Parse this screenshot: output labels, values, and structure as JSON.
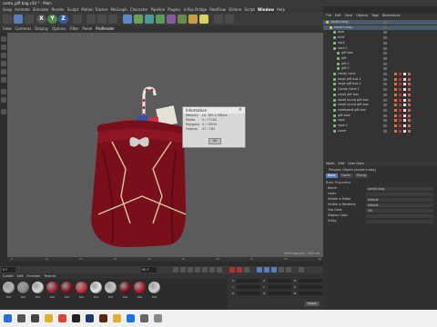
{
  "window": {
    "title": "santa_gift bag.c4d * - Main"
  },
  "menubar": {
    "items": [
      "Snap",
      "Animate",
      "Simulate",
      "Render",
      "Sculpt",
      "Motion Tracker",
      "MoGraph",
      "Character",
      "Pipeline",
      "Plugins",
      "V-Ray Bridge",
      "RealFlow",
      "Octane",
      "Script",
      "Window",
      "Help"
    ]
  },
  "toolbar": {
    "xyz": [
      "X",
      "Y",
      "Z"
    ]
  },
  "viewport_tabs": [
    "View",
    "Cameras",
    "Display",
    "Options",
    "Filter",
    "Panel",
    "ProRender"
  ],
  "viewport": {
    "grid_spacing": "Grid Spacing : 100 cm"
  },
  "info": {
    "title": "Information",
    "rows": [
      {
        "k": "Memory",
        "v": "ca. 189.2 MByte"
      },
      {
        "k": "Points",
        "v": "0 / 77182"
      },
      {
        "k": "Polygons",
        "v": "0 / 76930"
      },
      {
        "k": "Objects",
        "v": "47 / 284"
      }
    ],
    "ok": "OK"
  },
  "timeline": {
    "ticks": [
      "0",
      "10",
      "20",
      "30",
      "40",
      "50",
      "60",
      "70",
      "80",
      "90"
    ]
  },
  "playbar": {
    "frame": "0 F",
    "end_frame": "90 F"
  },
  "materials": {
    "menu": [
      "Create",
      "Edit",
      "Function",
      "Texture"
    ],
    "items": [
      {
        "label": "Mat",
        "color": "#b8b8b8"
      },
      {
        "label": "Mat",
        "color": "#8a8a8a"
      },
      {
        "label": "Mat",
        "color": "#d9d9d9"
      },
      {
        "label": "Mat",
        "color": "#a02030"
      },
      {
        "label": "Mat",
        "color": "#8a1020"
      },
      {
        "label": "Mat",
        "color": "#cc2a3a"
      },
      {
        "label": "Mat",
        "color": "#e8e8e8"
      },
      {
        "label": "Mat",
        "color": "#c8c8c8"
      },
      {
        "label": "Mat",
        "color": "#7a0c18"
      },
      {
        "label": "Mat",
        "color": "#b01a28"
      },
      {
        "label": "Mat",
        "color": "#d0d0d0"
      }
    ]
  },
  "coords": {
    "rows": [
      {
        "a": "X",
        "b": "X",
        "c": "H"
      },
      {
        "a": "Y",
        "b": "Y",
        "c": "P"
      },
      {
        "a": "Z",
        "b": "Z",
        "c": "B"
      }
    ],
    "apply": "Apply"
  },
  "object_manager": {
    "menu": [
      "File",
      "Edit",
      "View",
      "Objects",
      "Tags",
      "Bookmarks"
    ],
    "rows": [
      {
        "name": "santa's bag",
        "indent": 0,
        "color": "#d6c060",
        "sel": true
      },
      {
        "name": "santa's bag",
        "indent": 1,
        "color": "#d6c060",
        "sel": true
      },
      {
        "name": "bow",
        "indent": 2,
        "color": "#7fc07f",
        "sel": false
      },
      {
        "name": "knot",
        "indent": 2,
        "color": "#7fc07f",
        "sel": false
      },
      {
        "name": "sack",
        "indent": 2,
        "color": "#7fc07f",
        "sel": false
      },
      {
        "name": "sack.1",
        "indent": 2,
        "color": "#7fc07f",
        "sel": false
      },
      {
        "name": "gift box",
        "indent": 3,
        "color": "#7fc07f",
        "sel": false
      },
      {
        "name": "gift",
        "indent": 3,
        "color": "#7fc07f",
        "sel": false
      },
      {
        "name": "gift.1",
        "indent": 3,
        "color": "#7fc07f",
        "sel": false
      },
      {
        "name": "gift.2",
        "indent": 3,
        "color": "#7fc07f",
        "sel": false
      },
      {
        "name": "candy cane",
        "indent": 2,
        "color": "#7fc07f",
        "sel": false
      },
      {
        "name": "large gift box.1",
        "indent": 2,
        "color": "#7fc07f",
        "sel": false
      },
      {
        "name": "large gift box.2",
        "indent": 2,
        "color": "#7fc07f",
        "sel": false
      },
      {
        "name": "Candy Cane.1",
        "indent": 2,
        "color": "#7fc07f",
        "sel": false
      },
      {
        "name": "small gift box",
        "indent": 2,
        "color": "#7fc07f",
        "sel": false
      },
      {
        "name": "small round gift box",
        "indent": 2,
        "color": "#7fc07f",
        "sel": false
      },
      {
        "name": "small round gift box",
        "indent": 2,
        "color": "#7fc07f",
        "sel": false
      },
      {
        "name": "cardboard gift box",
        "indent": 2,
        "color": "#7fc07f",
        "sel": false
      },
      {
        "name": "gift bow",
        "indent": 2,
        "color": "#7fc07f",
        "sel": false
      },
      {
        "name": "rope",
        "indent": 2,
        "color": "#7fc07f",
        "sel": false
      },
      {
        "name": "rope.1",
        "indent": 2,
        "color": "#7fc07f",
        "sel": false
      },
      {
        "name": "cover",
        "indent": 2,
        "color": "#7fc07f",
        "sel": false
      }
    ]
  },
  "attributes": {
    "menu": [
      "Mode",
      "Edit",
      "User Data"
    ],
    "title": "Polygon Object [santa's bag]",
    "tabs": [
      "Basic",
      "Coord.",
      "Phong"
    ],
    "active_tab": "Basic",
    "section": "Basic Properties",
    "rows": [
      {
        "label": "Name",
        "value": "santa's bag"
      },
      {
        "label": "Layer",
        "value": ""
      },
      {
        "label": "Visible in Editor",
        "value": "Default"
      },
      {
        "label": "Visible in Renderer",
        "value": "Default"
      },
      {
        "label": "Use Color",
        "value": "Off"
      },
      {
        "label": "Display Color",
        "value": ""
      },
      {
        "label": "X-Ray",
        "value": ""
      }
    ]
  },
  "taskbar": {
    "apps": [
      "windows",
      "search",
      "task-view",
      "explorer",
      "chrome",
      "cinema4d",
      "photoshop",
      "illustrator",
      "folder",
      "mail",
      "settings",
      "other"
    ]
  }
}
